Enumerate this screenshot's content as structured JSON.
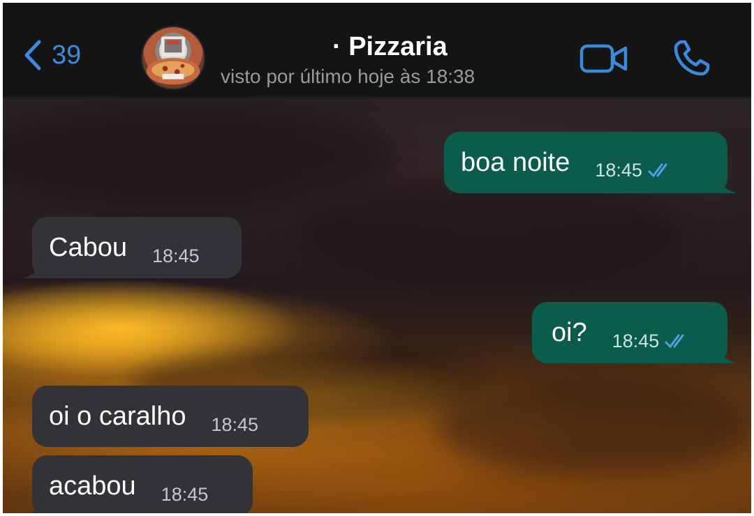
{
  "header": {
    "back_count": "39",
    "contact_name": "· Pizzaria",
    "last_seen": "visto por último hoje às 18:38",
    "icons": {
      "back": "chevron-left-icon",
      "video": "video-camera-icon",
      "call": "phone-icon"
    },
    "accent_color": "#3b8bdc"
  },
  "messages": [
    {
      "direction": "outgoing",
      "text": "boa noite",
      "time": "18:45",
      "status": "read"
    },
    {
      "direction": "incoming",
      "text": "Cabou",
      "time": "18:45"
    },
    {
      "direction": "outgoing",
      "text": "oi?",
      "time": "18:45",
      "status": "read"
    },
    {
      "direction": "incoming",
      "text": "oi o caralho",
      "time": "18:45"
    },
    {
      "direction": "incoming",
      "text": "acabou",
      "time": "18:45"
    }
  ],
  "colors": {
    "outgoing_bubble": "#0b5c4c",
    "incoming_bubble": "#333236",
    "read_tick": "#4fa3e8"
  }
}
